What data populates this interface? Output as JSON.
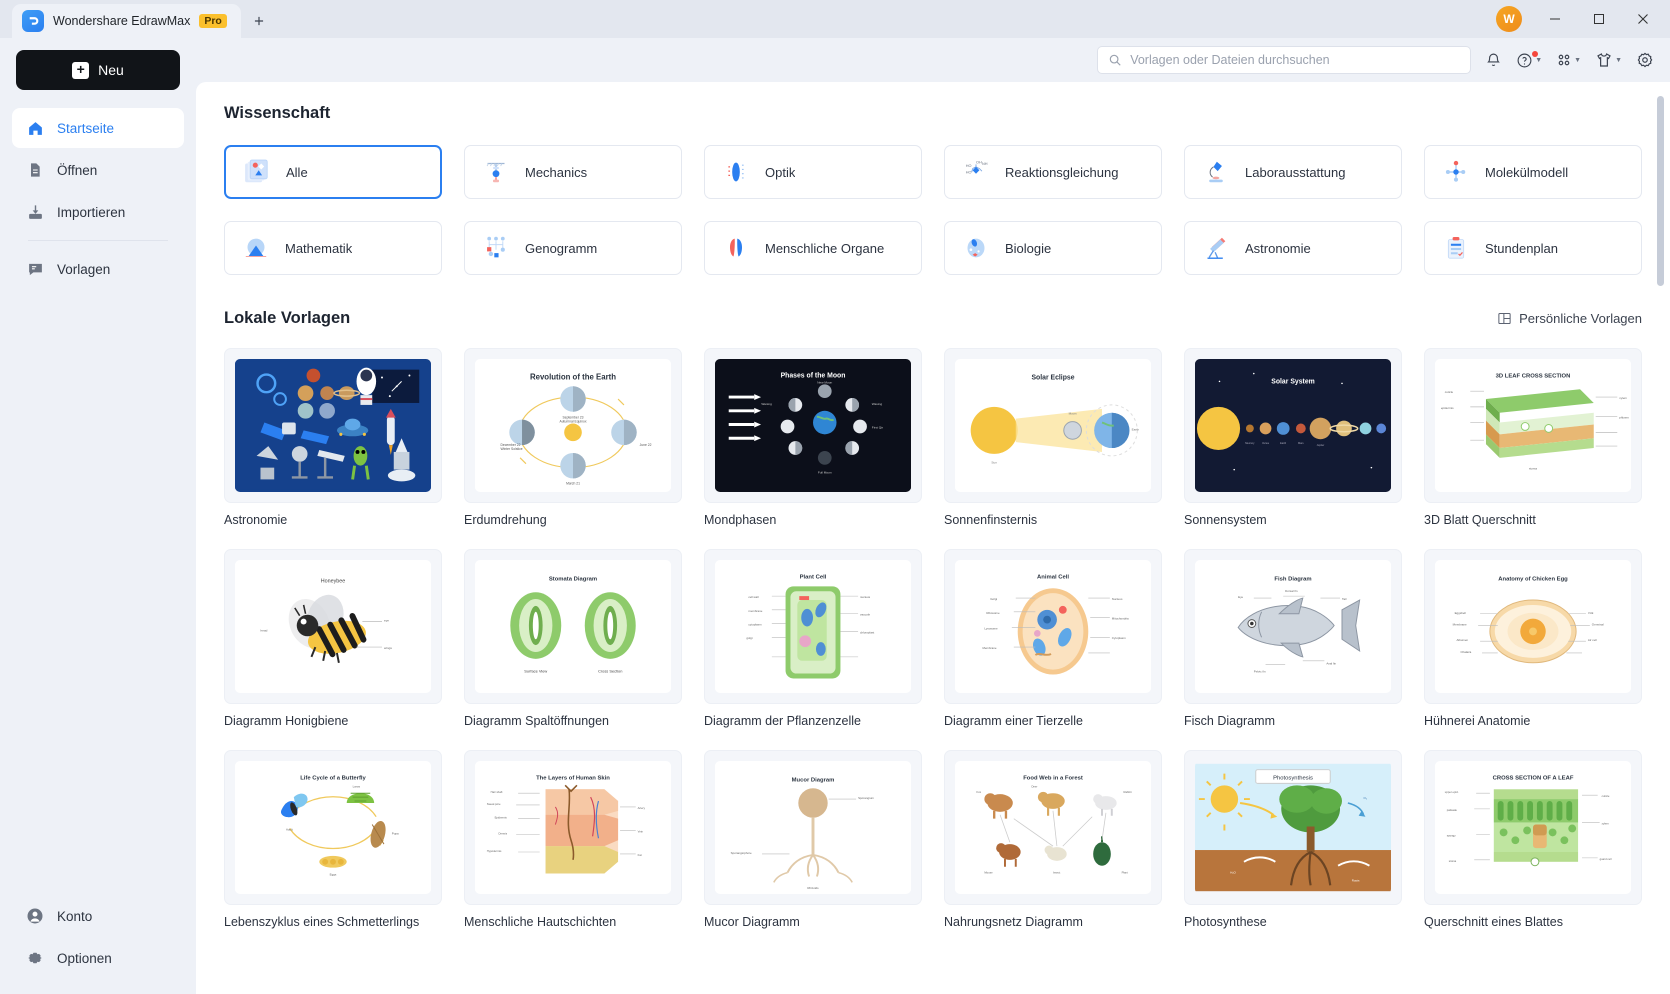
{
  "window": {
    "tab_title": "Wondershare EdrawMax",
    "pro_badge": "Pro",
    "new_tab_icon": "plus-icon",
    "avatar_initial": "W",
    "minimize": "–",
    "maximize": "☐",
    "close": "✕"
  },
  "sidebar": {
    "new_button": "Neu",
    "items": [
      {
        "label": "Startseite",
        "icon": "home-icon",
        "active": true
      },
      {
        "label": "Öffnen",
        "icon": "document-icon",
        "active": false
      },
      {
        "label": "Importieren",
        "icon": "import-icon",
        "active": false
      },
      {
        "label": "Vorlagen",
        "icon": "templates-icon",
        "active": false
      }
    ],
    "bottom_items": [
      {
        "label": "Konto",
        "icon": "account-icon"
      },
      {
        "label": "Optionen",
        "icon": "gear-icon"
      }
    ]
  },
  "topbar": {
    "search_placeholder": "Vorlagen oder Dateien durchsuchen",
    "search_value": "",
    "search_icon": "search-icon",
    "icons": [
      {
        "name": "bell-icon",
        "caret": false,
        "badge": false
      },
      {
        "name": "help-icon",
        "caret": true,
        "badge": true
      },
      {
        "name": "apps-grid-icon",
        "caret": true,
        "badge": false
      },
      {
        "name": "theme-shirt-icon",
        "caret": true,
        "badge": false
      },
      {
        "name": "settings-gear-icon",
        "caret": false,
        "badge": false
      }
    ]
  },
  "main": {
    "science_title": "Wissenschaft",
    "local_title": "Lokale Vorlagen",
    "personal_templates": "Persönliche Vorlagen",
    "personal_icon": "panel-layout-icon",
    "categories": [
      {
        "label": "Alle",
        "icon": "all-shapes-icon",
        "selected": true
      },
      {
        "label": "Mechanics",
        "icon": "mechanics-icon",
        "selected": false
      },
      {
        "label": "Optik",
        "icon": "optics-icon",
        "selected": false
      },
      {
        "label": "Reaktionsgleichung",
        "icon": "chemistry-icon",
        "selected": false
      },
      {
        "label": "Laborausstattung",
        "icon": "microscope-icon",
        "selected": false
      },
      {
        "label": "Molekülmodell",
        "icon": "molecule-icon",
        "selected": false
      },
      {
        "label": "Mathematik",
        "icon": "math-icon",
        "selected": false
      },
      {
        "label": "Genogramm",
        "icon": "genogram-icon",
        "selected": false
      },
      {
        "label": "Menschliche Organe",
        "icon": "organs-icon",
        "selected": false
      },
      {
        "label": "Biologie",
        "icon": "biology-icon",
        "selected": false
      },
      {
        "label": "Astronomie",
        "icon": "telescope-icon",
        "selected": false
      },
      {
        "label": "Stundenplan",
        "icon": "schedule-icon",
        "selected": false
      }
    ],
    "templates": [
      {
        "label": "Astronomie",
        "thumb": "astronomy-collage",
        "caption": ""
      },
      {
        "label": "Erdumdrehung",
        "thumb": "earth-revolution",
        "caption": "Revolution of the Earth"
      },
      {
        "label": "Mondphasen",
        "thumb": "moon-phases",
        "caption": "Phases of the Moon"
      },
      {
        "label": "Sonnenfinsternis",
        "thumb": "solar-eclipse",
        "caption": "Solar Eclipse"
      },
      {
        "label": "Sonnensystem",
        "thumb": "solar-system",
        "caption": "Solar System"
      },
      {
        "label": "3D Blatt Querschnitt",
        "thumb": "leaf-cross-section-3d",
        "caption": "3D LEAF CROSS SECTION"
      },
      {
        "label": "Diagramm Honigbiene",
        "thumb": "honeybee",
        "caption": "Honeybee"
      },
      {
        "label": "Diagramm Spaltöffnungen",
        "thumb": "stomata",
        "caption": "Stomata Diagram"
      },
      {
        "label": "Diagramm der Pflanzenzelle",
        "thumb": "plant-cell",
        "caption": "Plant Cell"
      },
      {
        "label": "Diagramm einer Tierzelle",
        "thumb": "animal-cell",
        "caption": "Animal Cell"
      },
      {
        "label": "Fisch Diagramm",
        "thumb": "fish",
        "caption": "Fish Diagram"
      },
      {
        "label": "Hühnerei Anatomie",
        "thumb": "chicken-egg",
        "caption": "Anatomy of Chicken Egg"
      },
      {
        "label": "Lebenszyklus eines Schmetterlings",
        "thumb": "butterfly-lifecycle",
        "caption": "Life Cycle of a Butterfly"
      },
      {
        "label": "Menschliche Hautschichten",
        "thumb": "human-skin",
        "caption": "The Layers of Human Skin"
      },
      {
        "label": "Mucor Diagramm",
        "thumb": "mucor",
        "caption": "Mucor Diagram"
      },
      {
        "label": "Nahrungsnetz Diagramm",
        "thumb": "food-web",
        "caption": "Food Web in a Forest"
      },
      {
        "label": "Photosynthese",
        "thumb": "photosynthesis",
        "caption": "Photosynthesis"
      },
      {
        "label": "Querschnitt eines Blattes",
        "thumb": "leaf-cross-section",
        "caption": "CROSS SECTION OF A LEAF"
      }
    ]
  },
  "colors": {
    "accent": "#2b7ff0",
    "pro": "#fbc02d",
    "bg": "#eef1f7",
    "panel": "#ffffff"
  }
}
